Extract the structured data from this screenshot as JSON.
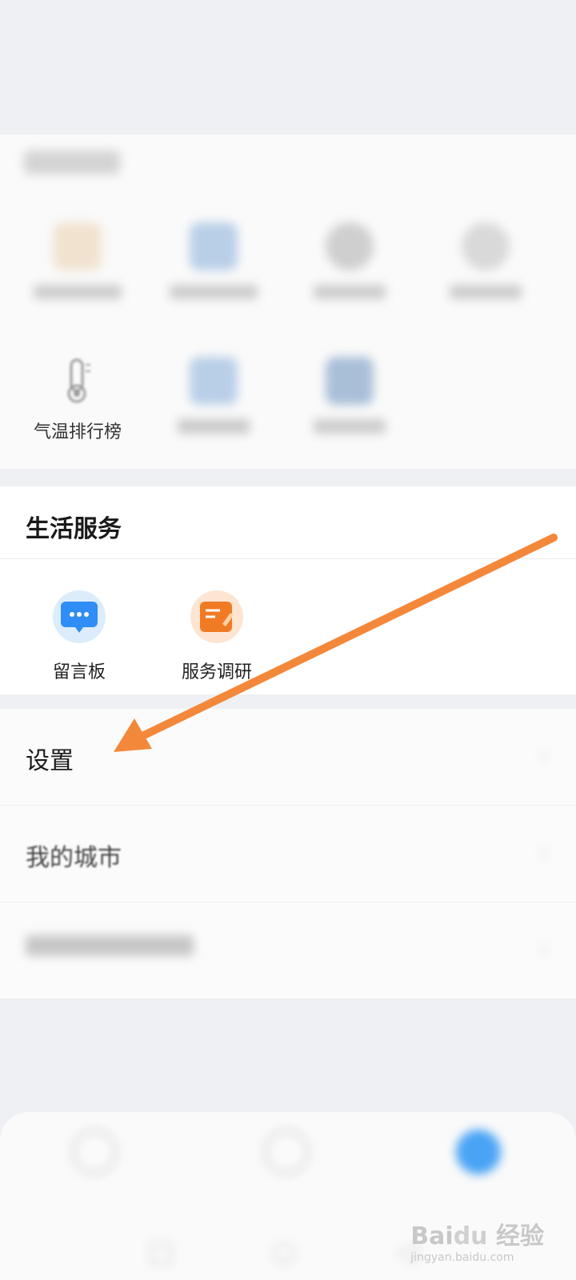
{
  "tools": {
    "items": [
      {
        "label": "气温排行榜",
        "row": 2,
        "col": 1
      }
    ]
  },
  "life_services": {
    "title": "生活服务",
    "items": [
      {
        "label": "留言板",
        "icon": "message-board-icon",
        "color": "#2f8df5"
      },
      {
        "label": "服务调研",
        "icon": "survey-icon",
        "color": "#f07b24"
      }
    ]
  },
  "list": {
    "rows": [
      {
        "label": "设置"
      },
      {
        "label": "我的城市"
      }
    ]
  },
  "annotation": {
    "arrow_color": "#f4883a"
  }
}
